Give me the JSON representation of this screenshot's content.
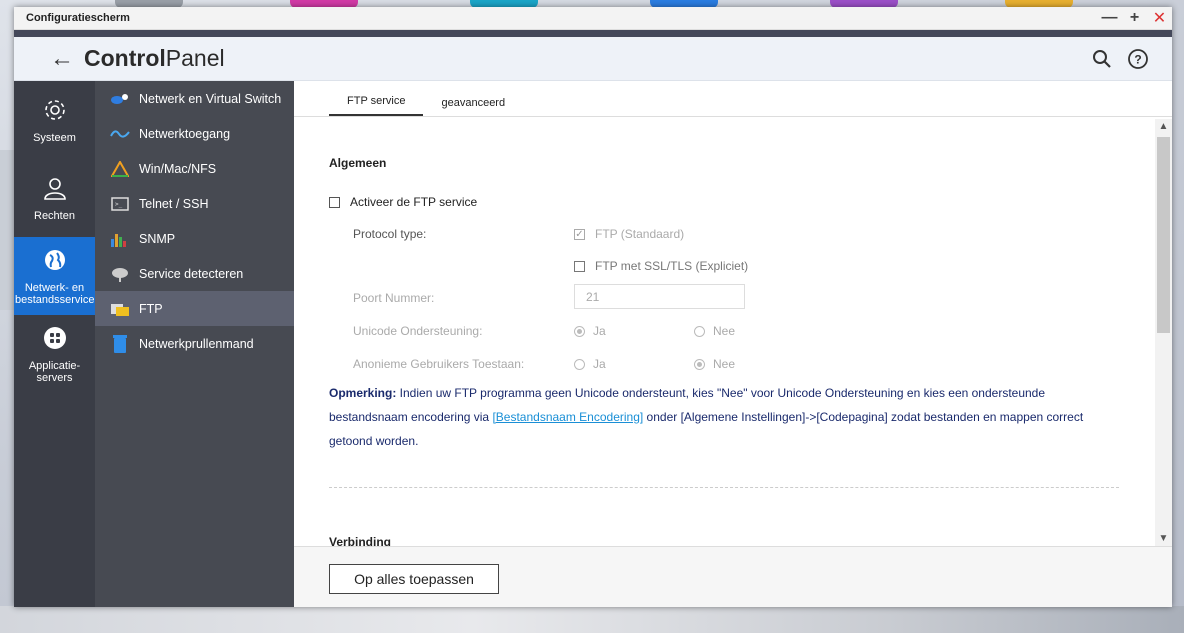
{
  "window": {
    "title": "Configuratiescherm"
  },
  "header": {
    "title_bold": "Control",
    "title_light": "Panel"
  },
  "nav_primary": [
    {
      "label": "Systeem",
      "icon": "gear-icon"
    },
    {
      "label": "Rechten",
      "icon": "user-icon"
    },
    {
      "label": "Netwerk- en bestandsservices",
      "icon": "globe-icon",
      "active": true
    },
    {
      "label": "Applicatie-servers",
      "icon": "apps-icon"
    }
  ],
  "nav_secondary": [
    {
      "label": "Netwerk en Virtual Switch"
    },
    {
      "label": "Netwerktoegang"
    },
    {
      "label": "Win/Mac/NFS"
    },
    {
      "label": "Telnet / SSH"
    },
    {
      "label": "SNMP"
    },
    {
      "label": "Service detecteren"
    },
    {
      "label": "FTP",
      "active": true
    },
    {
      "label": "Netwerkprullenmand"
    }
  ],
  "tabs": [
    {
      "label": "FTP service",
      "active": true
    },
    {
      "label": "geavanceerd"
    }
  ],
  "form": {
    "section_general": "Algemeen",
    "enable_label": "Activeer de FTP service",
    "protocol_label": "Protocol type:",
    "ftp_standard": "FTP (Standaard)",
    "ftp_ssl": "FTP met SSL/TLS (Expliciet)",
    "port_label": "Poort Nummer:",
    "port_value": "21",
    "unicode_label": "Unicode Ondersteuning:",
    "anon_label": "Anonieme Gebruikers Toestaan:",
    "yes": "Ja",
    "no": "Nee",
    "section_connection": "Verbinding"
  },
  "note": {
    "prefix": "Opmerking:",
    "text1": " Indien uw FTP programma geen Unicode ondersteunt, kies \"Nee\" voor Unicode Ondersteuning en kies een ondersteunde bestandsnaam encodering via ",
    "link": "[Bestandsnaam Encodering]",
    "text2": " onder [Algemene Instellingen]->[Codepagina] zodat bestanden en mappen correct getoond worden."
  },
  "footer": {
    "apply_label": "Op alles toepassen"
  },
  "colors": {
    "accent": "#1a6fd1",
    "nav_dark": "#3a3d46",
    "nav_mid": "#474a52"
  }
}
